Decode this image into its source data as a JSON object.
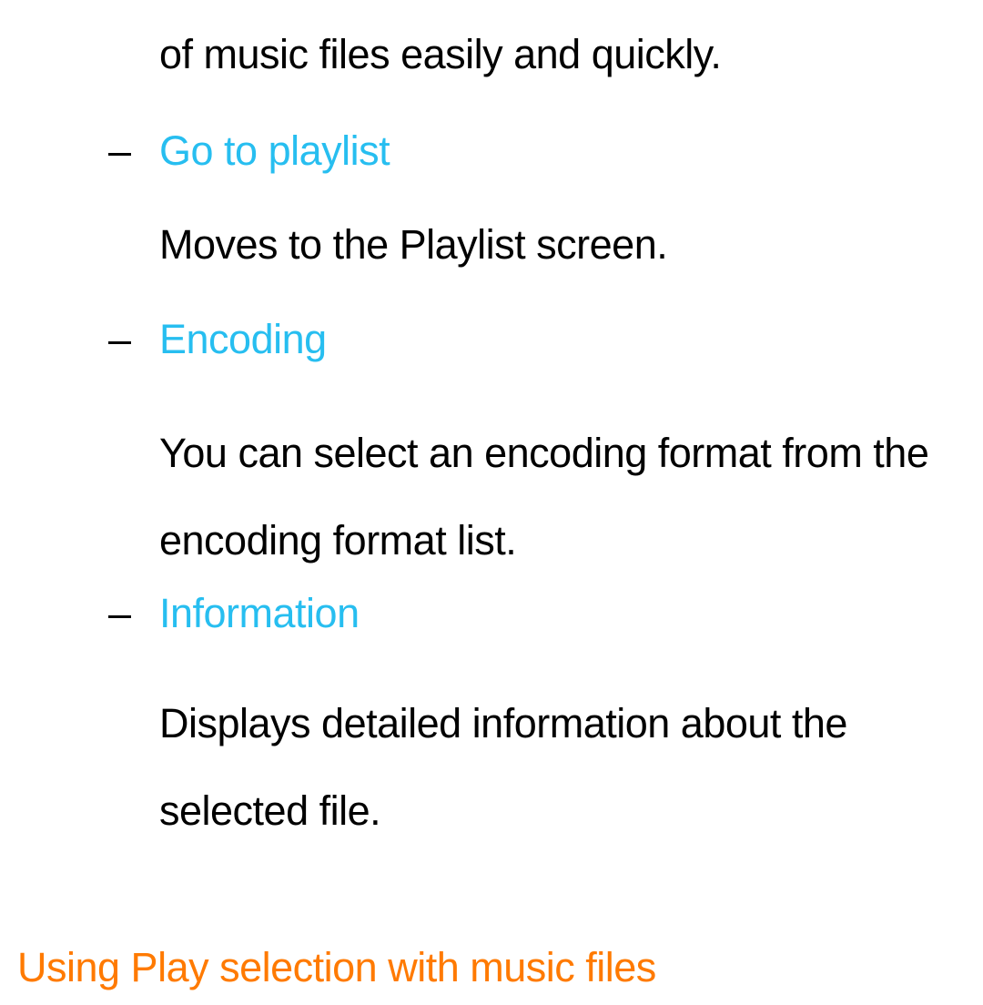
{
  "fragment": {
    "lead_tail": "of music files easily and quickly."
  },
  "items": [
    {
      "title": "Go to playlist",
      "desc": "Moves to the Playlist screen."
    },
    {
      "title": "Encoding",
      "desc": "You can select an encoding format from the encoding format list."
    },
    {
      "title": "Information",
      "desc": "Displays detailed information about the selected file."
    }
  ],
  "section_heading": "Using Play selection with music files",
  "dash": "–"
}
